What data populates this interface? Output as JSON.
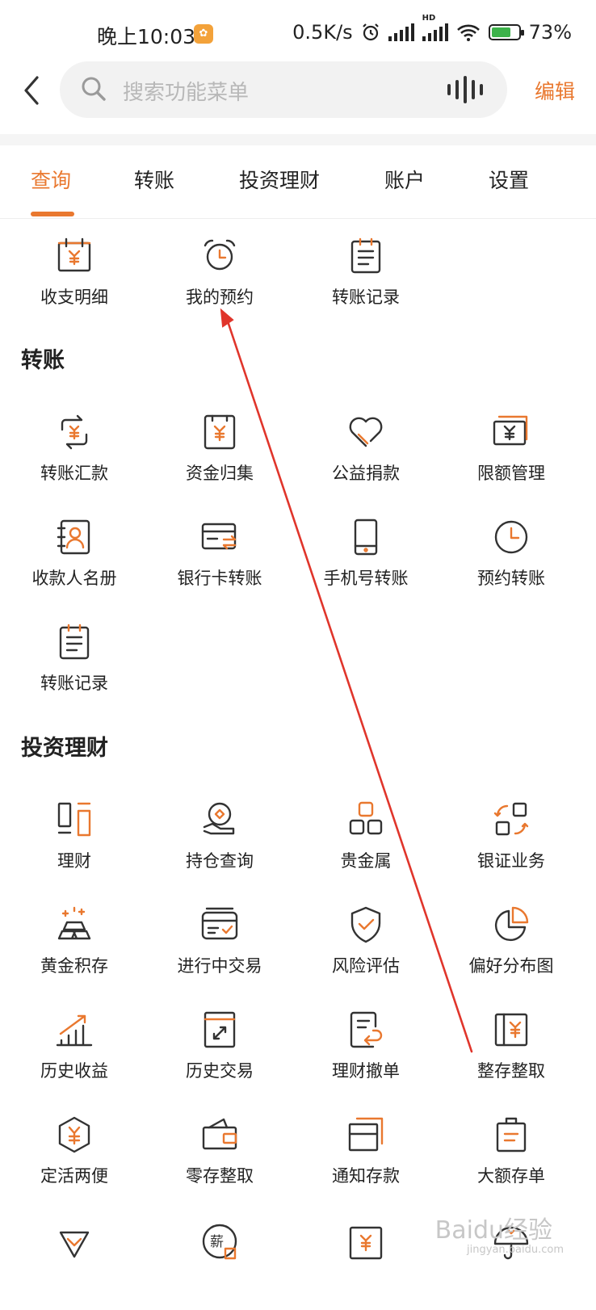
{
  "status_bar": {
    "time": "晚上10:03",
    "speed": "0.5K/s",
    "hd": "HD",
    "battery": "73%",
    "battery_level": 0.73
  },
  "header": {
    "search_placeholder": "搜索功能菜单",
    "edit_label": "编辑"
  },
  "tabs": [
    {
      "label": "查询",
      "active": true
    },
    {
      "label": "转账",
      "active": false
    },
    {
      "label": "投资理财",
      "active": false
    },
    {
      "label": "账户",
      "active": false
    },
    {
      "label": "设置",
      "active": false
    }
  ],
  "query_items": [
    {
      "label": "收支明细",
      "icon": "calendar-yen-icon"
    },
    {
      "label": "我的预约",
      "icon": "alarm-clock-icon"
    },
    {
      "label": "转账记录",
      "icon": "clipboard-list-icon"
    }
  ],
  "transfer_section": {
    "title": "转账",
    "items": [
      {
        "label": "转账汇款",
        "icon": "exchange-yen-icon"
      },
      {
        "label": "资金归集",
        "icon": "money-collect-icon"
      },
      {
        "label": "公益捐款",
        "icon": "heart-icon"
      },
      {
        "label": "限额管理",
        "icon": "banknote-icon"
      },
      {
        "label": "收款人名册",
        "icon": "contact-book-icon"
      },
      {
        "label": "银行卡转账",
        "icon": "card-transfer-icon"
      },
      {
        "label": "手机号转账",
        "icon": "mobile-phone-icon"
      },
      {
        "label": "预约转账",
        "icon": "clock-icon"
      },
      {
        "label": "转账记录",
        "icon": "clipboard-list-icon"
      }
    ]
  },
  "invest_section": {
    "title": "投资理财",
    "items": [
      {
        "label": "理财",
        "icon": "finance-icon"
      },
      {
        "label": "持仓查询",
        "icon": "holdings-icon"
      },
      {
        "label": "贵金属",
        "icon": "metal-blocks-icon"
      },
      {
        "label": "银证业务",
        "icon": "bank-securities-icon"
      },
      {
        "label": "黄金积存",
        "icon": "gold-bars-icon"
      },
      {
        "label": "进行中交易",
        "icon": "pending-trade-icon"
      },
      {
        "label": "风险评估",
        "icon": "shield-check-icon"
      },
      {
        "label": "偏好分布图",
        "icon": "pie-chart-icon"
      },
      {
        "label": "历史收益",
        "icon": "rising-chart-icon"
      },
      {
        "label": "历史交易",
        "icon": "history-trade-icon"
      },
      {
        "label": "理财撤单",
        "icon": "cancel-order-icon"
      },
      {
        "label": "整存整取",
        "icon": "deposit-book-icon"
      },
      {
        "label": "定活两便",
        "icon": "hexagon-yen-icon"
      },
      {
        "label": "零存整取",
        "icon": "wallet-icon"
      },
      {
        "label": "通知存款",
        "icon": "notice-deposit-icon"
      },
      {
        "label": "大额存单",
        "icon": "large-deposit-icon"
      }
    ]
  },
  "partial_row": [
    {
      "icon": "diamond-icon"
    },
    {
      "icon": "salary-icon",
      "glyph": "薪"
    },
    {
      "icon": "yen-box-icon"
    },
    {
      "icon": "umbrella-icon"
    }
  ],
  "watermark": {
    "text": "Baidu经验",
    "sub": "jingyan.baidu.com"
  }
}
